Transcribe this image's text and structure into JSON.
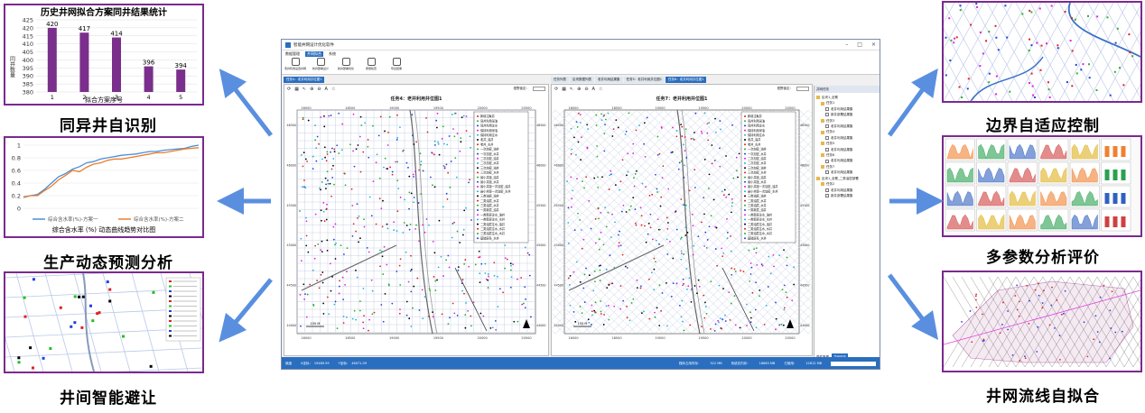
{
  "captions": {
    "top_left": "同异井自识别",
    "mid_left": "生产动态预测分析",
    "bottom_left": "井间智能避让",
    "top_right": "边界自适应控制",
    "mid_right": "多参数分析评价",
    "bottom_right": "井网流线自拟合"
  },
  "bar_chart": {
    "chart_data": {
      "type": "bar",
      "title": "历史井网拟合方案同井结果统计",
      "categories": [
        "1",
        "2",
        "3",
        "4",
        "5"
      ],
      "values": [
        420,
        417,
        414,
        396,
        394
      ],
      "ylabel": "同井数量",
      "xlabel": "拟合方案序号",
      "yticks": [
        "425",
        "420",
        "415",
        "410",
        "405",
        "400",
        "395",
        "390",
        "385",
        "380"
      ],
      "ylim": [
        380,
        425
      ],
      "color": "#7b2f8c"
    }
  },
  "line_chart": {
    "chart_data": {
      "type": "line",
      "title": "综合含水率 (%) 动态曲线趋势对比图",
      "yticks": [
        "1",
        "0.8",
        "0.6",
        "0.4",
        "0.2",
        "0"
      ],
      "ylim": [
        0,
        1
      ],
      "series": [
        {
          "name": "综合含水率(%)-方案一",
          "color": "#4a8fd8",
          "values": [
            0.18,
            0.2,
            0.22,
            0.3,
            0.4,
            0.5,
            0.55,
            0.62,
            0.66,
            0.72,
            0.74,
            0.78,
            0.8,
            0.82,
            0.84,
            0.85,
            0.86,
            0.88,
            0.9,
            0.9,
            0.92,
            0.93,
            0.94,
            0.95,
            0.98,
            1.0
          ]
        },
        {
          "name": "综合含水率(%)-方案二",
          "color": "#ee7d2a",
          "values": [
            0.17,
            0.2,
            0.2,
            0.28,
            0.35,
            0.45,
            0.52,
            0.6,
            0.58,
            0.65,
            0.7,
            0.72,
            0.76,
            0.78,
            0.78,
            0.8,
            0.82,
            0.84,
            0.86,
            0.88,
            0.88,
            0.9,
            0.92,
            0.94,
            0.95,
            0.96
          ]
        }
      ]
    }
  },
  "app": {
    "title": "智能井网设计优化软件",
    "menu": [
      "数据管理",
      "井网拟合",
      "系统"
    ],
    "active_menu_index": 1,
    "ribbon": [
      "老井利用设置井网",
      "新井部署设计",
      "新井部署优化",
      "质量检查",
      "导出结果"
    ],
    "left_tab": "任务4：老井利用井位图1",
    "right_tabs": [
      "任务列表",
      "区块数据列表",
      "老井利用结果集",
      "任务5：老井利用井位图1",
      "任务6：老井利用井位图1"
    ],
    "left_map_title": "任务4：老井利用井位图1",
    "right_map_title": "任务7：老井利用井位图1",
    "view_label": "视野锁定：",
    "x_ticks": [
      "16000",
      "18500",
      "19000",
      "19500",
      "20000",
      "20500"
    ],
    "y_ticks": [
      "46500",
      "46000",
      "45500",
      "45000",
      "44500",
      "44000"
    ],
    "legend": [
      "新增注聚井",
      "同井利用采油",
      "同井利用注水",
      "保持利用采油",
      "保持利用注水",
      "老井_油井",
      "老井_水井",
      "一次加密_油井",
      "一次加密_水井",
      "二次加密_油井",
      "二次加密_水井",
      "三次加密_油井",
      "三次加密_水井",
      "最小井距_油井",
      "最小井距_水井",
      "最小井距一次加密_油井",
      "最小井距一次加密_水井",
      "三类油层_油井",
      "二类油层_水井",
      "三类油层_水井",
      "一类新层_油井",
      "一类新层注水_油井",
      "一类新层注水_水井",
      "二类油层注水_油井",
      "二类油层注水_水井",
      "三类油层注水_水井",
      "基础层系_水井"
    ],
    "tree_header": "井网任务",
    "tree": [
      {
        "label": "区块1_全覆",
        "level": 0,
        "kind": "folder"
      },
      {
        "label": "任务1",
        "level": 1,
        "kind": "folder"
      },
      {
        "label": "老井利用结果集",
        "level": 2,
        "kind": "doc"
      },
      {
        "label": "新井部署结果集",
        "level": 2,
        "kind": "doc"
      },
      {
        "label": "任务3",
        "level": 1,
        "kind": "folder"
      },
      {
        "label": "老井利用结果集",
        "level": 2,
        "kind": "doc"
      },
      {
        "label": "任务4",
        "level": 1,
        "kind": "folder"
      },
      {
        "label": "老井利用结果集",
        "level": 2,
        "kind": "doc"
      },
      {
        "label": "任务5",
        "level": 1,
        "kind": "folder"
      },
      {
        "label": "老井利用结果集",
        "level": 2,
        "kind": "doc"
      },
      {
        "label": "任务6",
        "level": 1,
        "kind": "folder"
      },
      {
        "label": "老井利用结果集",
        "level": 2,
        "kind": "doc"
      },
      {
        "label": "任务7",
        "level": 1,
        "kind": "folder"
      },
      {
        "label": "老井利用结果集",
        "level": 2,
        "kind": "doc"
      },
      {
        "label": "区块1_全覆_二类油层部署",
        "level": 0,
        "kind": "folder"
      },
      {
        "label": "任务2",
        "level": 1,
        "kind": "folder"
      },
      {
        "label": "老井利用结果集",
        "level": 2,
        "kind": "doc"
      },
      {
        "label": "新井部署结果集",
        "level": 2,
        "kind": "doc"
      }
    ],
    "tree_footer": [
      "属性数据",
      "井网任务"
    ],
    "status": [
      "就绪",
      "X坐标：",
      "19489.59",
      "Y坐标：",
      "46071.09"
    ],
    "status_right": [
      "程序占用内存：",
      "522 MB",
      "系统总内存：",
      "16683 MB",
      "已使用：",
      "12612 MB"
    ],
    "scale_label": "155 M"
  },
  "colors": {
    "panel_border": "#7a2a8e",
    "arrow": "#5a8fe0",
    "accent": "#2a6ebf"
  }
}
